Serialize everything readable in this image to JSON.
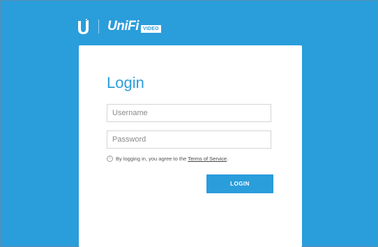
{
  "brand": {
    "logo_icon": "ubiquiti-u-logo-icon",
    "product_name": "UniFi",
    "product_suffix": "VIDEO"
  },
  "login": {
    "title": "Login",
    "username_placeholder": "Username",
    "username_value": "",
    "password_placeholder": "Password",
    "password_value": "",
    "notice_prefix": "By logging in, you agree to the",
    "terms_link": "Terms of Service",
    "notice_suffix": ".",
    "notice_icon": "info-icon",
    "submit_label": "LOGIN"
  },
  "colors": {
    "background": "#2a9ddb",
    "accent": "#2a9ddb",
    "card": "#ffffff"
  }
}
